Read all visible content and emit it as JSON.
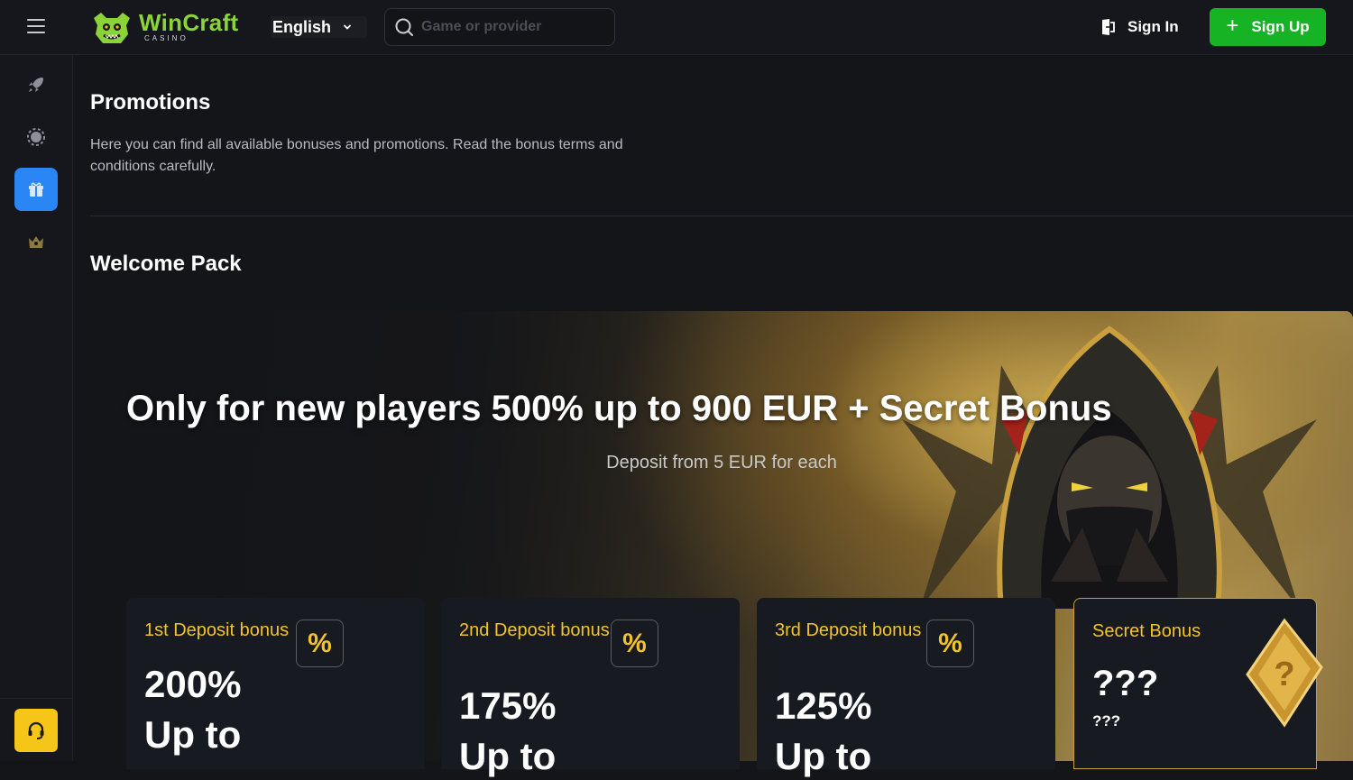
{
  "header": {
    "logo_text": "WinCraft",
    "logo_sub": "CASINO",
    "language": "English",
    "search_placeholder": "Game or provider",
    "sign_in": "Sign In",
    "sign_up": "Sign Up",
    "sign_up_icon": "+"
  },
  "sidebar": {
    "items": [
      {
        "icon": "rocket-icon"
      },
      {
        "icon": "chip-icon"
      },
      {
        "icon": "gift-icon",
        "active": true
      },
      {
        "icon": "crown-icon"
      }
    ],
    "support_icon": "headset-icon"
  },
  "main": {
    "title": "Promotions",
    "description": "Here you can find all available bonuses and promotions. Read the bonus terms and conditions carefully.",
    "section_title": "Welcome Pack",
    "banner": {
      "title": "Only for new players 500% up to 900 EUR + Secret Bonus",
      "subtitle": "Deposit from 5 EUR for each"
    },
    "cards": [
      {
        "title": "1st Deposit bonus",
        "badge": "%",
        "value": "200%",
        "upto": "Up to"
      },
      {
        "title": "2nd Deposit bonus",
        "badge": "%",
        "value": "175%",
        "upto": "Up to"
      },
      {
        "title": "3rd Deposit bonus",
        "badge": "%",
        "value": "125%",
        "upto": "Up to"
      },
      {
        "title": "Secret Bonus",
        "value": "???",
        "note": "???"
      }
    ]
  },
  "colors": {
    "accent_green": "#16b424",
    "active_blue": "#2b86f5",
    "gold": "#f3c327",
    "support_yellow": "#f5c518"
  }
}
